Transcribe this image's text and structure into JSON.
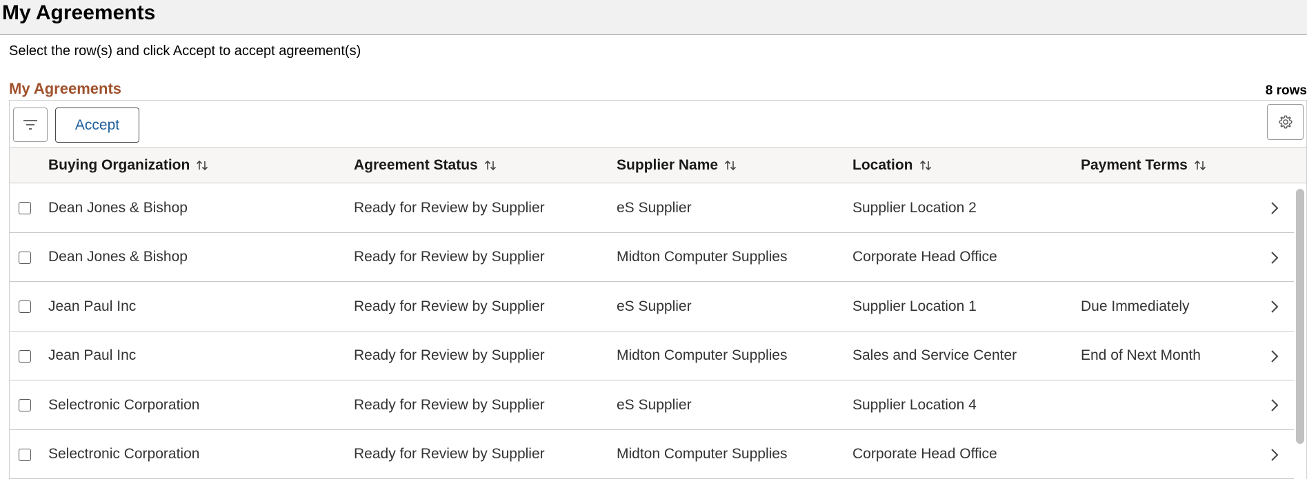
{
  "page": {
    "title": "My Agreements",
    "instructions": "Select the row(s) and click Accept to accept agreement(s)"
  },
  "grid": {
    "title": "My Agreements",
    "row_count": "8 rows",
    "accept_label": "Accept",
    "columns": [
      {
        "label": "Buying Organization"
      },
      {
        "label": "Agreement Status"
      },
      {
        "label": "Supplier Name"
      },
      {
        "label": "Location"
      },
      {
        "label": "Payment Terms"
      }
    ],
    "rows": [
      {
        "buying_org": "Dean Jones & Bishop",
        "status": "Ready for Review by Supplier",
        "supplier": "eS Supplier",
        "location": "Supplier Location 2",
        "terms": ""
      },
      {
        "buying_org": "Dean Jones & Bishop",
        "status": "Ready for Review by Supplier",
        "supplier": "Midton Computer Supplies",
        "location": "Corporate Head Office",
        "terms": ""
      },
      {
        "buying_org": "Jean Paul Inc",
        "status": "Ready for Review by Supplier",
        "supplier": "eS Supplier",
        "location": "Supplier Location 1",
        "terms": "Due Immediately"
      },
      {
        "buying_org": "Jean Paul Inc",
        "status": "Ready for Review by Supplier",
        "supplier": "Midton Computer Supplies",
        "location": "Sales and Service Center",
        "terms": "End of Next Month"
      },
      {
        "buying_org": "Selectronic Corporation",
        "status": "Ready for Review by Supplier",
        "supplier": "eS Supplier",
        "location": "Supplier Location 4",
        "terms": ""
      },
      {
        "buying_org": "Selectronic Corporation",
        "status": "Ready for Review by Supplier",
        "supplier": "Midton Computer Supplies",
        "location": "Corporate Head Office",
        "terms": ""
      }
    ]
  },
  "icons": {
    "filter": "filter-icon",
    "settings": "gear-icon",
    "sort": "sort-arrows-icon",
    "row_action": "chevron-right-icon"
  },
  "colors": {
    "grid_title": "#a0522d",
    "accept_text": "#1f5f9c",
    "header_bg": "#f1f1f1"
  }
}
